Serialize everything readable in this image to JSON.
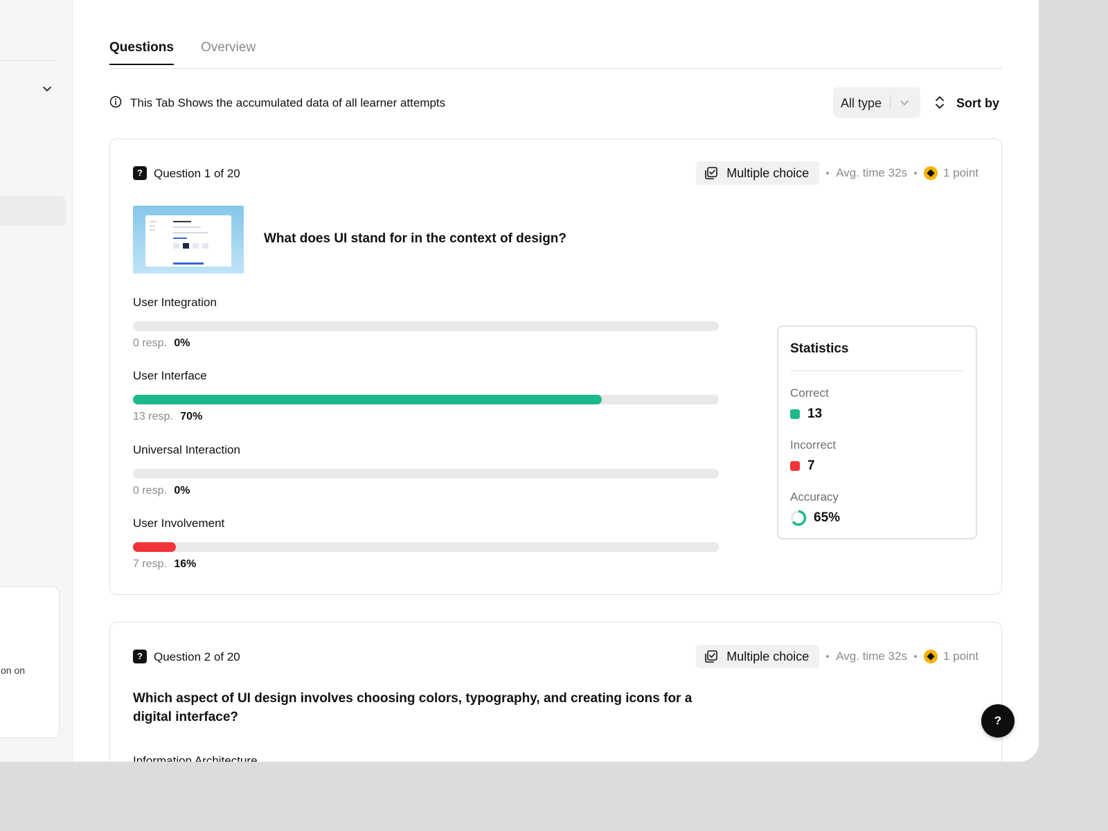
{
  "sidebar": {
    "card_text": "on on"
  },
  "tabs": [
    {
      "label": "Questions",
      "active": true
    },
    {
      "label": "Overview",
      "active": false
    }
  ],
  "info": {
    "text": "This Tab Shows the accumulated data of all learner attempts",
    "icon": "info-icon"
  },
  "filter": {
    "type_select": "All type",
    "sort_label": "Sort by"
  },
  "questions": [
    {
      "number": "Question 1 of 20",
      "type": "Multiple choice",
      "avg_time": "Avg. time 32s",
      "points": "1 point",
      "title": "What does UI stand for in the context of design?",
      "answers": [
        {
          "label": "User Integration",
          "resp": "0 resp.",
          "pct": "0%",
          "fraction": 0.0,
          "status": "neutral"
        },
        {
          "label": "User Interface",
          "resp": "13 resp.",
          "pct": "70%",
          "fraction": 0.8,
          "status": "correct"
        },
        {
          "label": "Universal Interaction",
          "resp": "0 resp.",
          "pct": "0%",
          "fraction": 0.0,
          "status": "neutral"
        },
        {
          "label": "User Involvement",
          "resp": "7 resp.",
          "pct": "16%",
          "fraction": 0.073,
          "status": "incorrect"
        }
      ],
      "statistics": {
        "title": "Statistics",
        "correct_label": "Correct",
        "correct_value": "13",
        "incorrect_label": "Incorrect",
        "incorrect_value": "7",
        "accuracy_label": "Accuracy",
        "accuracy_value": "65%",
        "accuracy_fraction": 0.65
      }
    },
    {
      "number": "Question 2 of 20",
      "type": "Multiple choice",
      "avg_time": "Avg. time 32s",
      "points": "1 point",
      "title": "Which aspect of UI design involves choosing colors, typography, and creating icons for a digital interface?",
      "answers": [
        {
          "label": "Information Architecture"
        }
      ]
    }
  ],
  "help_button": "?",
  "colors": {
    "correct": "#1db98a",
    "incorrect": "#f2333a",
    "accent_point": "#f6b400",
    "track": "#e9e9e9"
  }
}
